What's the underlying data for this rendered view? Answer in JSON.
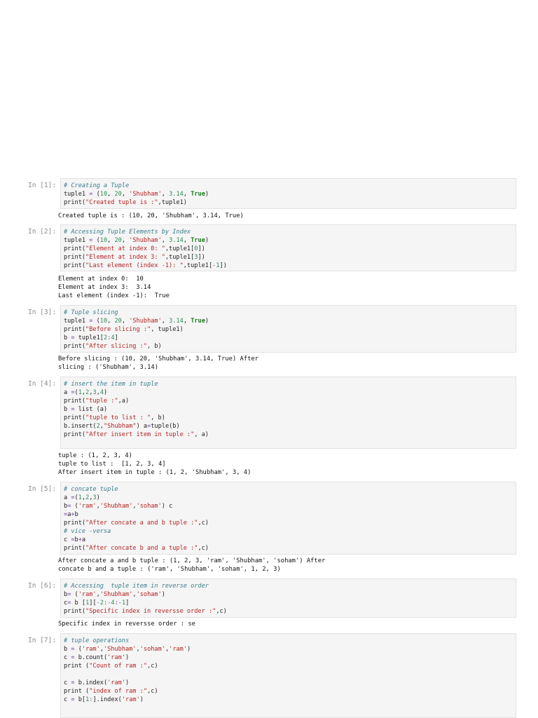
{
  "cells": [
    {
      "prompt": "In [1]:",
      "code": [
        "# Creating a Tuple",
        "tuple1 = (10, 20, 'Shubham', 3.14, True)",
        "print(\"Created tuple is :\",tuple1)"
      ],
      "output": [
        "Created tuple is : (10, 20, 'Shubham', 3.14, True)"
      ]
    },
    {
      "prompt": "In [2]:",
      "code": [
        "# Accessing Tuple Elements by Index",
        "tuple1 = (10, 20, 'Shubham', 3.14, True)",
        "print(\"Element at index 0: \",tuple1[0])",
        "print(\"Element at index 3: \",tuple1[3])",
        "print(\"Last element (index -1): \",tuple1[-1])"
      ],
      "output": [
        "Element at index 0:  10",
        "Element at index 3:  3.14",
        "Last element (index -1):  True"
      ]
    },
    {
      "prompt": "In [3]:",
      "code": [
        "# Tuple slicing",
        "tuple1 = (10, 20, 'Shubham', 3.14, True)",
        "print(\"Before slicing :\", tuple1)",
        "b = tuple1[2:4]",
        "print(\"After slicing :\", b)"
      ],
      "output": [
        "Before slicing : (10, 20, 'Shubham', 3.14, True) After",
        "slicing : ('Shubham', 3.14)"
      ]
    },
    {
      "prompt": "In [4]:",
      "code": [
        "# insert the item in tuple",
        "a =(1,2,3,4)",
        "print(\"tuple :\",a)",
        "b = list (a)",
        "print(\"tuple to list : \", b)",
        "b.insert(2,\"Shubham\") a=tuple(b)",
        "print(\"After insert item in tuple :\", a)",
        ""
      ],
      "output": [
        "tuple : (1, 2, 3, 4)",
        "tuple to list :  [1, 2, 3, 4]",
        "After insert item in tuple : (1, 2, 'Shubham', 3, 4)"
      ]
    },
    {
      "prompt": "In [5]:",
      "code": [
        "# concate tuple",
        "a =(1,2,3)",
        "b= ('ram','Shubham','soham') c",
        "=a+b",
        "print(\"After concate a and b tuple :\",c)",
        "# vice -versa",
        "c =b+a",
        "print(\"After concate b and a tuple :\",c)"
      ],
      "output": [
        "After concate a and b tuple : (1, 2, 3, 'ram', 'Shubham', 'soham') After",
        "concate b and a tuple : ('ram', 'Shubham', 'soham', 1, 2, 3)"
      ]
    },
    {
      "prompt": "In [6]:",
      "code": [
        "# Accessing  tuple item in reverse order",
        "b= ('ram','Shubham','soham')",
        "c= b [1][-2:-4:-1]",
        "print(\"Specific index in reversse order :\",c)"
      ],
      "output": [
        "Specific index in reversse order : se"
      ]
    },
    {
      "prompt": "In [7]:",
      "code": [
        "# tuple operations",
        "b = ('ram','Shubham','soham','ram')",
        "c = b.count('ram')",
        "print (\"Count of ram :\",c)",
        "",
        "c = b.index('ram')",
        "print (\"index of ram :\",c)",
        "c = b[1:].index('ram')"
      ],
      "output": []
    }
  ]
}
